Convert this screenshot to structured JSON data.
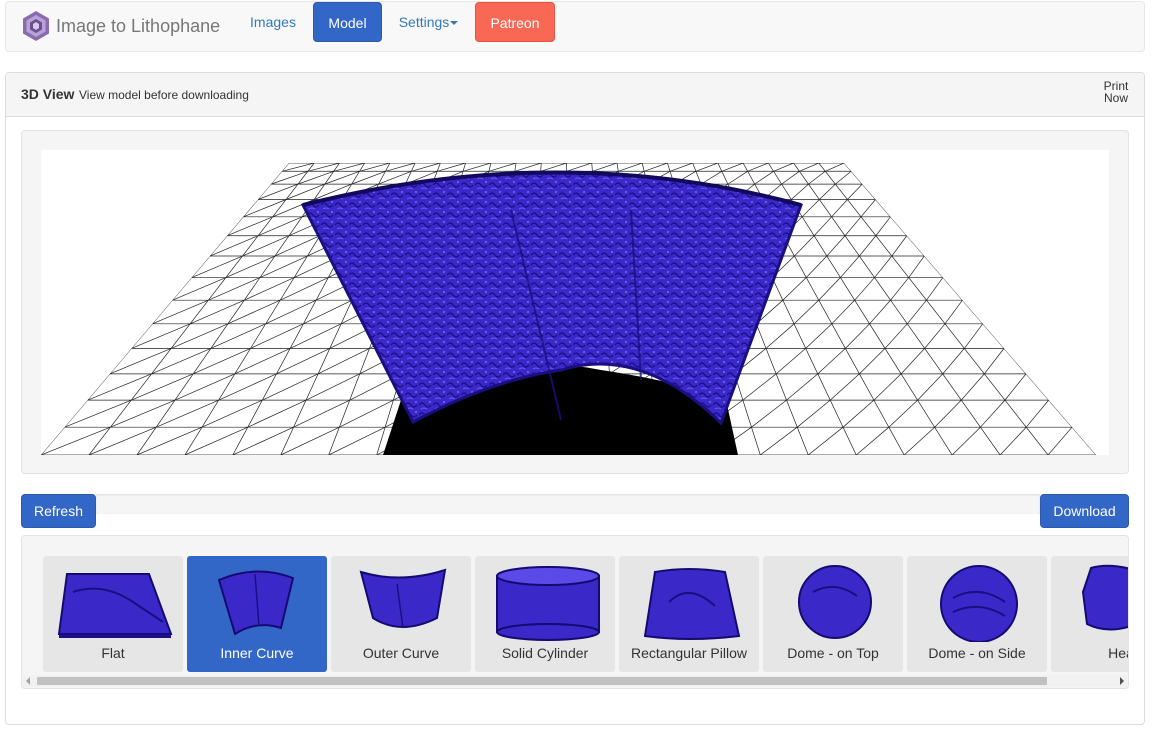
{
  "brand": {
    "name": "Image to Lithophane",
    "logo_icon": "hexagon-logo-icon"
  },
  "nav": {
    "images": "Images",
    "model": "Model",
    "settings": "Settings",
    "patreon": "Patreon"
  },
  "panel": {
    "title": "3D View",
    "subtitle": "View model before downloading",
    "print_now": "Print Now"
  },
  "toolbar": {
    "refresh": "Refresh",
    "download": "Download"
  },
  "shapes": [
    {
      "label": "Flat",
      "active": false
    },
    {
      "label": "Inner Curve",
      "active": true
    },
    {
      "label": "Outer Curve",
      "active": false
    },
    {
      "label": "Solid Cylinder",
      "active": false
    },
    {
      "label": "Rectangular Pillow",
      "active": false
    },
    {
      "label": "Dome - on Top",
      "active": false
    },
    {
      "label": "Dome - on Side",
      "active": false
    },
    {
      "label": "Hea",
      "active": false
    }
  ],
  "colors": {
    "primary": "#3367c7",
    "patreon": "#f96854",
    "model": "#2d1fb8"
  }
}
